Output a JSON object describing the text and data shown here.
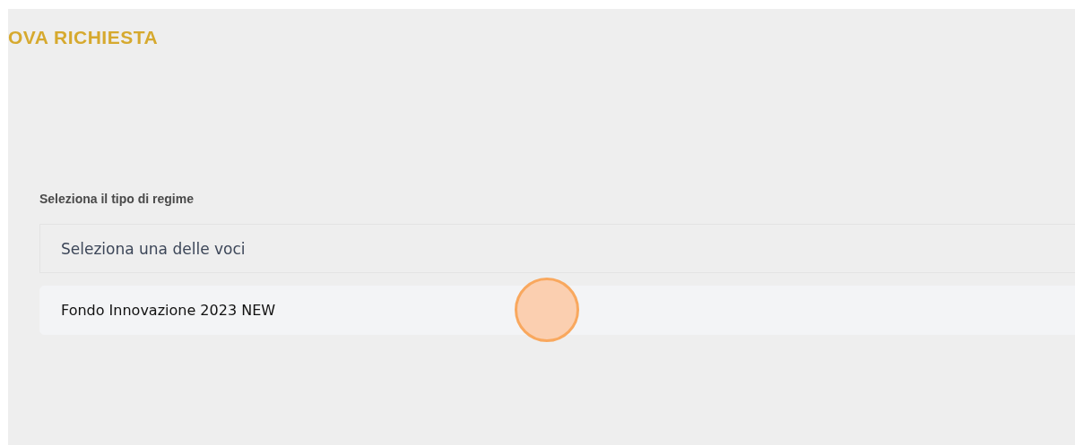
{
  "page": {
    "title": "OVA RICHIESTA"
  },
  "form": {
    "label": "Seleziona il tipo di regime",
    "select": {
      "placeholder": "Seleziona una delle voci"
    },
    "options": [
      {
        "label": "Fondo Innovazione 2023 NEW",
        "highlighted": true
      }
    ]
  }
}
